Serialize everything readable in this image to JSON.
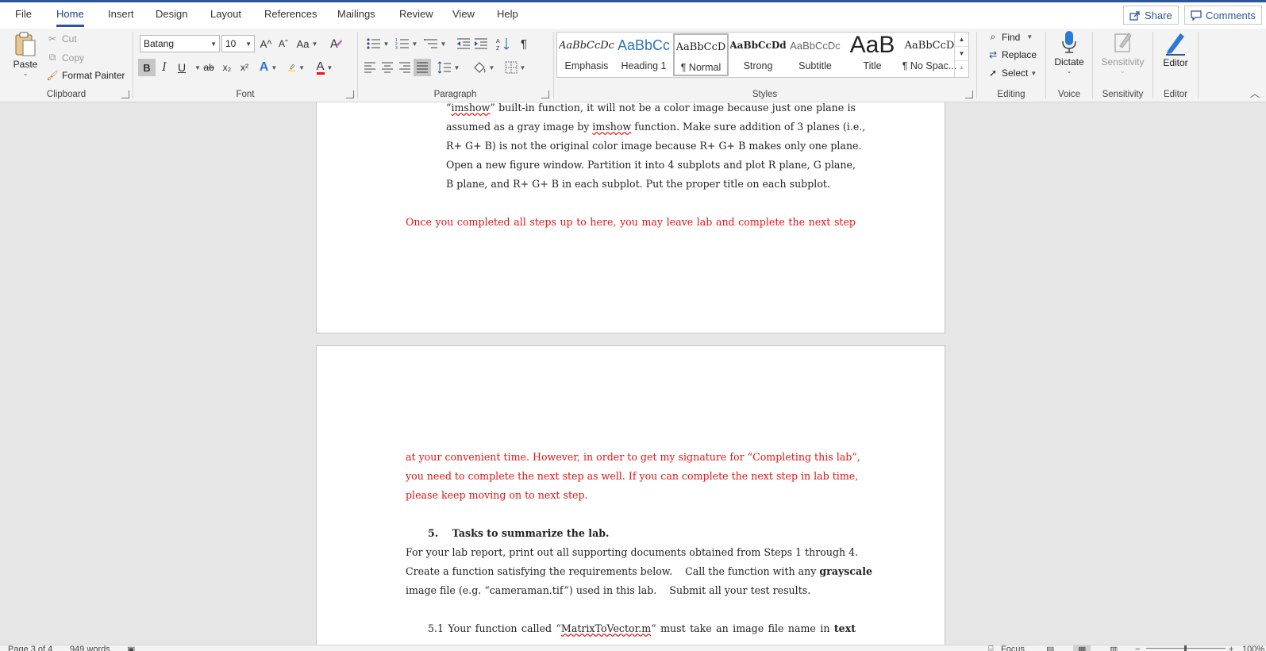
{
  "tabs": [
    "File",
    "Home",
    "Insert",
    "Design",
    "Layout",
    "References",
    "Mailings",
    "Review",
    "View",
    "Help"
  ],
  "active_tab": "Home",
  "share_label": "Share",
  "comments_label": "Comments",
  "clipboard": {
    "paste": "Paste",
    "cut": "Cut",
    "copy": "Copy",
    "format_painter": "Format Painter",
    "group_label": "Clipboard"
  },
  "font": {
    "family": "Batang",
    "size": "10",
    "group_label": "Font",
    "bold": "B",
    "italic": "I",
    "underline": "U",
    "strike": "ab",
    "sub": "x₂",
    "sup": "x²",
    "grow": "A^",
    "shrink": "Aˇ",
    "case": "Aa"
  },
  "paragraph": {
    "group_label": "Paragraph"
  },
  "styles": {
    "group_label": "Styles",
    "items": [
      {
        "preview": "AaBbCcDc",
        "name": "Emphasis"
      },
      {
        "preview": "AaBbCc",
        "name": "Heading 1"
      },
      {
        "preview": "AaBbCcD",
        "name": "¶ Normal"
      },
      {
        "preview": "AaBbCcDd",
        "name": "Strong"
      },
      {
        "preview": "AaBbCcDc",
        "name": "Subtitle"
      },
      {
        "preview": "AaB",
        "name": "Title"
      },
      {
        "preview": "AaBbCcD",
        "name": "¶ No Spac..."
      }
    ]
  },
  "editing": {
    "find": "Find",
    "replace": "Replace",
    "select": "Select",
    "group_label": "Editing"
  },
  "voice": {
    "dictate": "Dictate",
    "group_label": "Voice"
  },
  "sensitivity": {
    "button": "Sensitivity",
    "group_label": "Sensitivity"
  },
  "editor": {
    "button": "Editor",
    "group_label": "Editor"
  },
  "doc": {
    "p1_l1_a": "“",
    "p1_l1_b": "imshow",
    "p1_l1_c": "” built-in function, it will not be a color image because just one plane is",
    "p1_l2_a": "assumed as a gray image by ",
    "p1_l2_b": "imshow",
    "p1_l2_c": " function. Make sure addition of 3 planes (i.e.,",
    "p1_l3": "R+ G+ B) is not the original color image because R+ G+ B makes only one plane.",
    "p1_l4": "Open a new figure window. Partition it into 4 subplots and plot R plane, G plane,",
    "p1_l5": "B plane, and R+ G+ B in each subplot. Put the proper title on each subplot.",
    "red1": "Once you completed all steps up to here, you may leave lab and complete the next step",
    "red2": "at your convenient time. However, in order to get my signature for “Completing this lab”,",
    "red3": "you need to complete the next step as well. If you can complete the next step in lab time,",
    "red4": "please keep moving on to next step.",
    "heading": "5.    Tasks to summarize the lab.",
    "b1": "For your lab report, print out all supporting documents obtained from Steps 1 through 4.",
    "b2_a": "Create a function satisfying the requirements below.    Call the function with any ",
    "b2_b": "grayscale",
    "b3": "image file (e.g. “cameraman.tif”) used in this lab.    Submit all your test results.",
    "b4_a": "5.1 Your function called “",
    "b4_b": "MatrixToVector.m",
    "b4_c": "” must take an image file name in ",
    "b4_d": "text"
  },
  "status": {
    "page": "Page 3 of 4",
    "words": "949 words",
    "focus": "Focus",
    "zoom": "100%"
  }
}
